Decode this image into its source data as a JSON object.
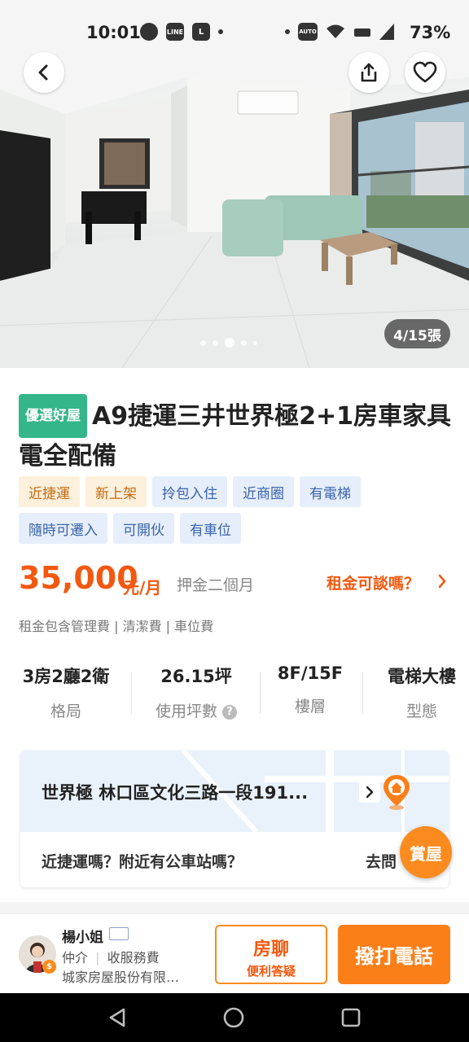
{
  "status_bar": {
    "time": "10:01",
    "battery": "73%",
    "left_icons": [
      "chat-icon",
      "line-icon",
      "app-l-icon"
    ],
    "right_icons": [
      "auto-hd-icon",
      "wifi-icon",
      "volte-icon",
      "signal-icon",
      "battery-icon"
    ],
    "auto_label": "AUTO",
    "line_label": "LINE",
    "l_label": "L"
  },
  "photo": {
    "counter": "4/15張",
    "dots": 5,
    "active_dot": 2
  },
  "listing": {
    "badge": "優選好屋",
    "title": "A9捷運三井世界極2+1房車家具電全配備",
    "tags": [
      {
        "label": "近捷運",
        "tone": "orange"
      },
      {
        "label": "新上架",
        "tone": "orange"
      },
      {
        "label": "拎包入住",
        "tone": "blue"
      },
      {
        "label": "近商圈",
        "tone": "blue"
      },
      {
        "label": "有電梯",
        "tone": "blue"
      },
      {
        "label": "隨時可遷入",
        "tone": "blue"
      },
      {
        "label": "可開伙",
        "tone": "blue"
      },
      {
        "label": "有車位",
        "tone": "blue"
      }
    ],
    "price": "35,000",
    "price_unit": "元/月",
    "deposit": "押金二個月",
    "negotiate": "租金可談嗎？",
    "fee_note": "租金包含管理費 | 清潔費 | 車位費"
  },
  "specs": [
    {
      "value": "3房2廳2衛",
      "label": "格局"
    },
    {
      "value": "26.15坪",
      "label": "使用坪數"
    },
    {
      "value": "8F/15F",
      "label": "樓層"
    },
    {
      "value": "電梯大樓",
      "label": "型態"
    }
  ],
  "location": {
    "address": "世界極 林口區文化三路一段191...",
    "question": "近捷運嗎？附近有公車站嗎？",
    "ask": "去問"
  },
  "reward_button": "賞屋",
  "agent": {
    "name": "楊小姐",
    "role": "仲介",
    "fee": "收服務費",
    "company": "城家房屋股份有限…",
    "avatar_badge": "$"
  },
  "actions": {
    "chat_title": "房聊",
    "chat_sub": "便利答疑",
    "call": "撥打電話"
  },
  "colors": {
    "accent": "#f2580f",
    "primary_button": "#fb7f19",
    "badge_green": "#35b58a",
    "tag_orange_bg": "#fdf0dc",
    "tag_blue_bg": "#e6eefb"
  }
}
